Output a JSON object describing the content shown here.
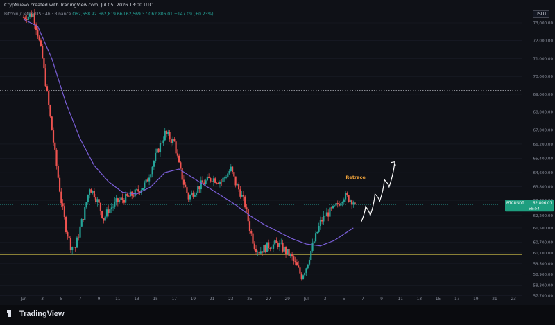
{
  "header": {
    "title": "CrypNuevo created with TradingView.com, Jul 05, 2026 13:00 UTC"
  },
  "legend": {
    "symbol": "Bitcoin / TetherUS · 4h · Binance",
    "ohlc": "O62,658.92 H62,819.66 L62,569.37 C62,806.01",
    "change": "+147.09 (+0.23%)"
  },
  "currency": "USDT",
  "colors": {
    "background": "#0f1117",
    "up": "#26a69a",
    "down": "#ef5350",
    "ma": "#7b5fd9",
    "support": "#b5a642",
    "annotation": "#f0a33b",
    "price_label": "#1e9e7f"
  },
  "price_label": {
    "symbol": "BTCUSDT",
    "price": "62,806.01",
    "countdown": "59:54"
  },
  "annotation": "Retrace",
  "footer": {
    "brand": "TradingView"
  },
  "chart_data": {
    "type": "candlestick",
    "y_axis_ticks": [
      "57,700.00",
      "58,300.00",
      "58,900.00",
      "59,500.00",
      "60,100.00",
      "60,700.00",
      "61,500.00",
      "62,200.00",
      "63,050.00",
      "63,800.00",
      "64,600.00",
      "65,400.00",
      "66,200.00",
      "67,000.00",
      "68,000.00",
      "69,000.00",
      "70,000.00",
      "71,000.00",
      "72,000.00",
      "73,000.00"
    ],
    "x_axis_ticks": [
      "Jun",
      "3",
      "5",
      "7",
      "9",
      "11",
      "13",
      "15",
      "17",
      "19",
      "21",
      "23",
      "25",
      "27",
      "29",
      "Jul",
      "3",
      "5",
      "7",
      "9",
      "11",
      "13",
      "15",
      "17",
      "19",
      "21",
      "23"
    ],
    "resistance_level": 69200,
    "support_level": 60000,
    "current_price": 62806.01,
    "price_path": [
      [
        0.0,
        73300
      ],
      [
        1.0,
        73500
      ],
      [
        1.5,
        72400
      ],
      [
        2.0,
        71000
      ],
      [
        2.5,
        69000
      ],
      [
        3.0,
        67000
      ],
      [
        3.5,
        65000
      ],
      [
        4.0,
        63000
      ],
      [
        4.5,
        61500
      ],
      [
        5.0,
        60500
      ],
      [
        5.5,
        60400
      ],
      [
        6.0,
        61500
      ],
      [
        6.5,
        62500
      ],
      [
        7.0,
        63800
      ],
      [
        7.5,
        63400
      ],
      [
        8.0,
        62800
      ],
      [
        8.5,
        62000
      ],
      [
        9.0,
        62500
      ],
      [
        10.0,
        63000
      ],
      [
        11.0,
        63200
      ],
      [
        12.0,
        63500
      ],
      [
        13.0,
        64000
      ],
      [
        14.0,
        65500
      ],
      [
        15.0,
        66800
      ],
      [
        16.0,
        66300
      ],
      [
        16.5,
        65000
      ],
      [
        17.0,
        64000
      ],
      [
        17.5,
        63200
      ],
      [
        18.0,
        63500
      ],
      [
        19.0,
        64000
      ],
      [
        20.0,
        64300
      ],
      [
        21.0,
        64100
      ],
      [
        22.0,
        64800
      ],
      [
        22.5,
        64000
      ],
      [
        23.0,
        63500
      ],
      [
        23.5,
        62800
      ],
      [
        24.0,
        61500
      ],
      [
        24.5,
        60500
      ],
      [
        25.0,
        60200
      ],
      [
        26.0,
        60500
      ],
      [
        27.0,
        60600
      ],
      [
        28.0,
        60100
      ],
      [
        28.5,
        59800
      ],
      [
        29.0,
        59300
      ],
      [
        29.5,
        58800
      ],
      [
        30.0,
        59300
      ],
      [
        30.5,
        60200
      ],
      [
        31.0,
        61000
      ],
      [
        31.5,
        61800
      ],
      [
        32.0,
        62200
      ],
      [
        33.0,
        62600
      ],
      [
        34.0,
        63300
      ],
      [
        35.0,
        63000
      ],
      [
        35.3,
        62806
      ]
    ],
    "moving_average": [
      [
        0.0,
        73200
      ],
      [
        1.5,
        72800
      ],
      [
        3.0,
        71000
      ],
      [
        4.5,
        68500
      ],
      [
        6.0,
        66500
      ],
      [
        7.5,
        65000
      ],
      [
        9.0,
        64100
      ],
      [
        10.5,
        63500
      ],
      [
        12.0,
        63400
      ],
      [
        13.5,
        63800
      ],
      [
        15.0,
        64600
      ],
      [
        16.5,
        64800
      ],
      [
        18.0,
        64300
      ],
      [
        19.5,
        63800
      ],
      [
        21.0,
        63300
      ],
      [
        22.5,
        62800
      ],
      [
        24.0,
        62200
      ],
      [
        25.5,
        61700
      ],
      [
        27.0,
        61300
      ],
      [
        28.5,
        60900
      ],
      [
        30.0,
        60600
      ],
      [
        31.5,
        60500
      ],
      [
        33.0,
        60800
      ],
      [
        35.0,
        61500
      ]
    ],
    "projection": [
      [
        35.8,
        61800
      ],
      [
        36.3,
        62700
      ],
      [
        36.8,
        62200
      ],
      [
        37.3,
        63400
      ],
      [
        37.8,
        63000
      ],
      [
        38.3,
        64200
      ],
      [
        38.8,
        63800
      ],
      [
        39.4,
        65200
      ]
    ]
  }
}
